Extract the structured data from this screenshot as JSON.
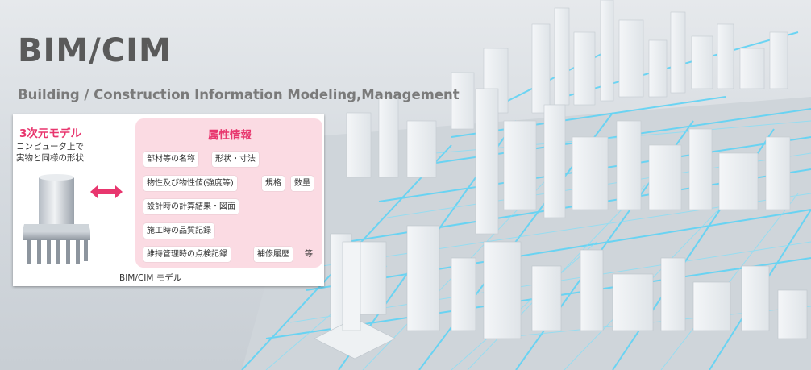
{
  "header": {
    "title": "BIM/CIM",
    "subtitle": "Building / Construction Information Modeling,Management"
  },
  "model_card": {
    "model_title": "3次元モデル",
    "model_desc_line1": "コンピュータ上で",
    "model_desc_line2": "実物と同様の形状",
    "attributes_title": "属性情報",
    "attributes": [
      "部材等の名称",
      "形状・寸法",
      "物性及び物性値(強度等)",
      "規格",
      "数量",
      "設計時の計算結果・図面",
      "施工時の品質記録",
      "維持管理時の点検記録",
      "補修履歴"
    ],
    "etc_label": "等",
    "caption": "BIM/CIM モデル"
  },
  "colors": {
    "accent": "#e8366e",
    "panel": "#fbdbe3",
    "road": "#5fd3f5",
    "title": "#5a5a5a"
  },
  "icons": {
    "hero": "city-3d-model-image",
    "arrow": "double-arrow-icon",
    "pillar": "bridge-pier-model-icon"
  }
}
